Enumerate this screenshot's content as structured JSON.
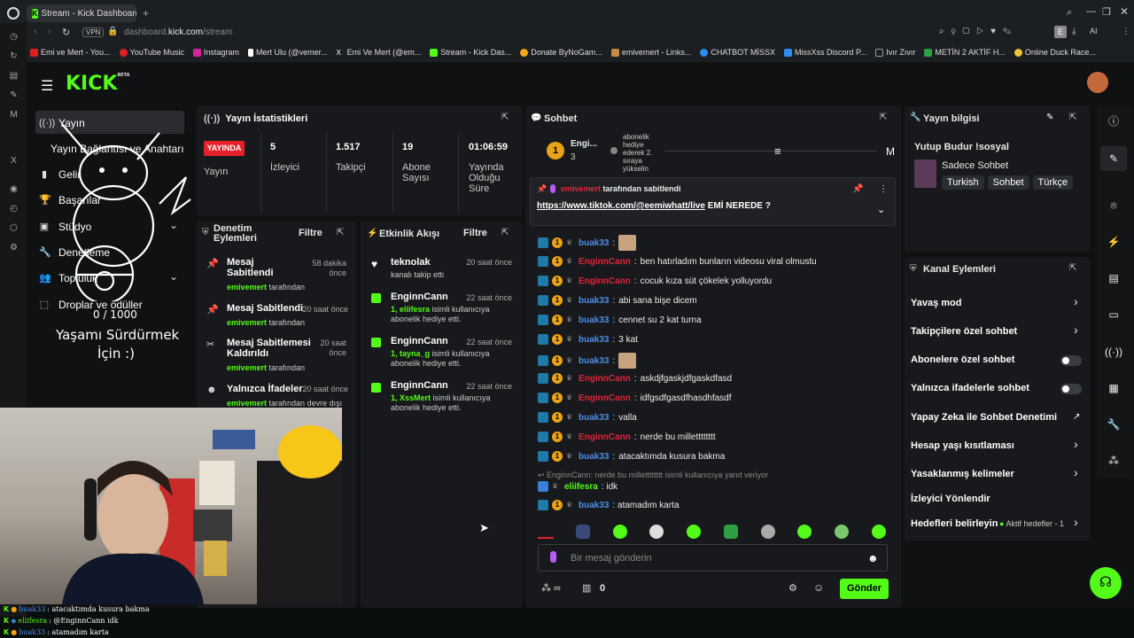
{
  "browser": {
    "tab_title": "Stream - Kick Dashboard",
    "url_prefix": "dashboard.",
    "url_domain": "kick.com",
    "url_path": "/stream",
    "vpn": "VPN",
    "bookmarks": [
      {
        "label": "Emi ve Mert - You...",
        "color": "#e02020"
      },
      {
        "label": "YouTube Music",
        "color": "#e02020"
      },
      {
        "label": "Instagram",
        "color": "#d6249f"
      },
      {
        "label": "Mert Ulu (@vemer...",
        "color": "#fff"
      },
      {
        "label": "Emi Ve Mert (@em...",
        "color": "#fff"
      },
      {
        "label": "Stream - Kick Das...",
        "color": "#53fc18"
      },
      {
        "label": "Donate ByNoGam...",
        "color": "#f7a51a"
      },
      {
        "label": "emivemert - Links...",
        "color": "#c88a3e"
      },
      {
        "label": "CHATBOT MİSSX",
        "color": "#2d8cf0"
      },
      {
        "label": "MissXss Discord P...",
        "color": "#2d8cf0"
      },
      {
        "label": "Ivır Zıvır",
        "color": "#999"
      },
      {
        "label": "METİN 2 AKTİF H...",
        "color": "#2ea043"
      },
      {
        "label": "Online Duck Race...",
        "color": "#f1c232"
      }
    ]
  },
  "sidebar": {
    "logo": "KICK",
    "logo_sup": "BETA",
    "items": [
      {
        "label": "Yayın"
      },
      {
        "label": "Yayın Bağlantısı ve Anahtarı"
      },
      {
        "label": "Gelir"
      },
      {
        "label": "Başarılar"
      },
      {
        "label": "Stüdyo"
      },
      {
        "label": "Denetleme"
      },
      {
        "label": "Topluluk"
      },
      {
        "label": "Droplar ve ödüller"
      }
    ]
  },
  "overlay": {
    "counter": "0 / 1000",
    "line1": "Yaşamı Sürdürmek",
    "line2": "İçin :)"
  },
  "stats": {
    "title": "Yayın İstatistikleri",
    "live": "YAYINDA",
    "live_label": "Yayın",
    "viewers": "5",
    "viewers_label": "İzleyici",
    "followers": "1.517",
    "followers_label": "Takipçi",
    "subs": "19",
    "subs_label1": "Abone",
    "subs_label2": "Sayısı",
    "duration": "01:06:59",
    "duration_label1": "Yayında",
    "duration_label2": "Olduğu",
    "duration_label3": "Süre"
  },
  "moderation": {
    "title1": "Denetim",
    "title2": "Eylemleri",
    "filter": "Filtre",
    "items": [
      {
        "t1": "Mesaj",
        "t2": "Sabitlendi",
        "user": "emivemert",
        "by": " tarafından",
        "time1": "58 dakika",
        "time2": "önce"
      },
      {
        "t1": "Mesaj Sabitlendi",
        "t2": "",
        "user": "emivemert",
        "by": " tarafından",
        "time1": "20 saat önce",
        "time2": ""
      },
      {
        "t1": "Mesaj Sabitlemesi",
        "t2": "Kaldırıldı",
        "user": "emivemert",
        "by": " tarafından",
        "time1": "20 saat",
        "time2": "önce"
      },
      {
        "t1": "Yalnızca İfadeler",
        "t2": "",
        "user": "emivemert",
        "by": " tarafından devre dışı",
        "time1": "20 saat önce",
        "time2": ""
      }
    ]
  },
  "activity": {
    "title": "Etkinlik Akışı",
    "filter": "Filtre",
    "items": [
      {
        "name": "teknolak",
        "desc1": "kanalı takip etti",
        "desc2": "",
        "highlight": "",
        "time": "20 saat önce"
      },
      {
        "name": "EnginnCann",
        "highlight": "1, eliifesra",
        "desc1": " isimli kullanıcıya",
        "desc2": "abonelik hediye etti.",
        "time": "22 saat önce"
      },
      {
        "name": "EnginnCann",
        "highlight": "1, tayna_g",
        "desc1": " isimli kullanıcıya",
        "desc2": "abonelik hediye etti.",
        "time": "22 saat önce"
      },
      {
        "name": "EnginnCann",
        "highlight": "1, XssMert",
        "desc1": " isimli kullanıcıya",
        "desc2": "abonelik hediye etti.",
        "time": "22 saat önce"
      }
    ]
  },
  "chat": {
    "title": "Sohbet",
    "top_user": "Engi...",
    "top_user_count": "3",
    "gift_text": [
      "abonelik",
      "hediye",
      "ederek 2.",
      "sıraya",
      "yükselin"
    ],
    "top_right": "M",
    "pinned_user": "emivemert",
    "pinned_by": " tarafından sabitlendi",
    "pinned_link": "https://www.tiktok.com/@eemiwhatt/live",
    "pinned_text": " EMİ NEREDE ?",
    "messages": [
      {
        "user": "buak33",
        "color": "blue",
        "text": "",
        "img": true
      },
      {
        "user": "EnginnCann",
        "color": "red",
        "text": "ben hatırladım bunların videosu viral olmustu"
      },
      {
        "user": "EnginnCann",
        "color": "red",
        "text": "cocuk kıza süt çökelek yolluyordu"
      },
      {
        "user": "buak33",
        "color": "blue",
        "text": "abi sana bişe dicem"
      },
      {
        "user": "buak33",
        "color": "blue",
        "text": "cennet su 2 kat turna"
      },
      {
        "user": "buak33",
        "color": "blue",
        "text": "3 kat"
      },
      {
        "user": "buak33",
        "color": "blue",
        "text": "",
        "img": true
      },
      {
        "user": "EnginnCann",
        "color": "red",
        "text": "askdjfgaskjdfgaskdfasd"
      },
      {
        "user": "EnginnCann",
        "color": "red",
        "text": "idfgsdfgasdfhasdhfasdf"
      },
      {
        "user": "buak33",
        "color": "blue",
        "text": "valla"
      },
      {
        "user": "EnginnCann",
        "color": "red",
        "text": "nerde bu milletttttttt"
      },
      {
        "user": "buak33",
        "color": "blue",
        "text": "atacaktımda kusura bakma"
      }
    ],
    "reply_note": "EnginnCann: nerde bu milletttttttt isimli kullanıcıya yanıt veriyor",
    "reply_user": "eliifesra",
    "reply_text": "idk",
    "last_user": "buak33",
    "last_text": "atamadım karta",
    "input_placeholder": "Bir mesaj gönderin",
    "points": "0",
    "send": "Gönder"
  },
  "stream_info": {
    "title": "Yayın bilgisi",
    "stream_title": "Yutup Budur !sosyal",
    "category": "Sadece Sohbet",
    "tags": [
      "Turkish",
      "Sohbet",
      "Türkçe"
    ]
  },
  "channel_actions": {
    "title": "Kanal Eylemleri",
    "items": [
      {
        "label": "Yavaş mod",
        "control": "chevron"
      },
      {
        "label": "Takipçilere özel sohbet",
        "control": "chevron"
      },
      {
        "label": "Abonelere özel sohbet",
        "control": "toggle"
      },
      {
        "label": "Yalnızca ifadelerle sohbet",
        "control": "toggle"
      },
      {
        "label": "Yapay Zeka ile Sohbet Denetimi",
        "control": "external"
      },
      {
        "label": "Hesap yaşı kısıtlaması",
        "control": "chevron"
      },
      {
        "label": "Yasaklanmış kelimeler",
        "control": "chevron"
      },
      {
        "label": "İzleyici Yönlendir",
        "control": "none"
      },
      {
        "label": "Hedefleri belirleyin",
        "control": "chevron"
      }
    ],
    "goal_status": "Aktif hedefler - 1"
  },
  "ticker": [
    {
      "user": "buak33",
      "text": ": atacaktımda kusura bakma"
    },
    {
      "user": "eliifesra",
      "text": ": @EnginnCann idk"
    },
    {
      "user": "buak33",
      "text": ": atamadım karta"
    }
  ],
  "colors": {
    "accent": "#53fc18",
    "live": "#e4212a",
    "panel": "#18191c",
    "user_red": "#e0243a",
    "user_blue": "#4e8ee8"
  }
}
